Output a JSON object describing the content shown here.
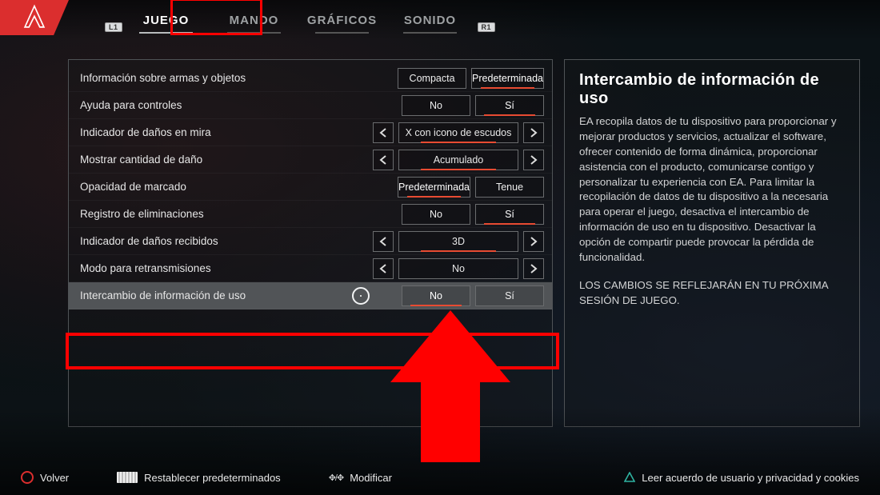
{
  "bumpers": {
    "left": "L1",
    "right": "R1"
  },
  "tabs": [
    {
      "id": "juego",
      "label": "JUEGO",
      "active": true
    },
    {
      "id": "mando",
      "label": "MANDO",
      "active": false
    },
    {
      "id": "graficos",
      "label": "GRÁFICOS",
      "active": false
    },
    {
      "id": "sonido",
      "label": "SONIDO",
      "active": false
    }
  ],
  "settings": [
    {
      "label": "Información sobre armas y objetos",
      "type": "toggle2",
      "options": [
        "Compacta",
        "Predeterminada"
      ],
      "selected": 1
    },
    {
      "label": "Ayuda para controles",
      "type": "toggle2",
      "options": [
        "No",
        "Sí"
      ],
      "selected": 1
    },
    {
      "label": "Indicador de daños en mira",
      "type": "stepper",
      "value": "X con icono de escudos"
    },
    {
      "label": "Mostrar cantidad de daño",
      "type": "stepper",
      "value": "Acumulado"
    },
    {
      "label": "Opacidad de marcado",
      "type": "toggle2",
      "options": [
        "Predeterminada",
        "Tenue"
      ],
      "selected": 0
    },
    {
      "label": "Registro de eliminaciones",
      "type": "toggle2",
      "options": [
        "No",
        "Sí"
      ],
      "selected": 1
    },
    {
      "label": "Indicador de daños recibidos",
      "type": "stepper",
      "value": "3D"
    },
    {
      "label": "Modo para retransmisiones",
      "type": "stepper",
      "value": "No",
      "noUnderline": true
    },
    {
      "label": "Intercambio de información de uso",
      "type": "toggle2",
      "options": [
        "No",
        "Sí"
      ],
      "selected": 0,
      "highlighted": true,
      "cursor": true
    }
  ],
  "info": {
    "title": "Intercambio de información de uso",
    "body": "EA recopila datos de tu dispositivo para proporcionar y mejorar productos y servicios, actualizar el software, ofrecer contenido de forma dinámica, proporcionar asistencia con el producto, comunicarse contigo y personalizar tu experiencia con EA. Para limitar la recopilación de datos de tu dispositivo a la necesaria para operar el juego, desactiva el intercambio de información de uso en tu dispositivo. Desactivar la opción de compartir puede provocar la pérdida de funcionalidad.",
    "body2": "LOS CAMBIOS SE REFLEJARÁN EN TU PRÓXIMA SESIÓN DE JUEGO."
  },
  "footer": {
    "back": "Volver",
    "reset": "Restablecer predeterminados",
    "modify": "Modificar",
    "legal": "Leer acuerdo de usuario y privacidad y cookies"
  }
}
